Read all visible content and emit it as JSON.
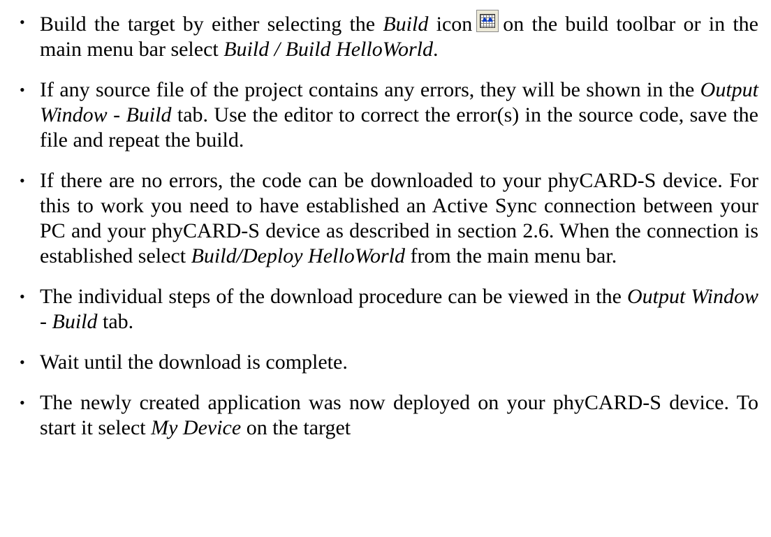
{
  "bullet_glyph": "•",
  "items": [
    {
      "parts": [
        {
          "t": "Build the target by either selecting the "
        },
        {
          "t": "Build",
          "i": true
        },
        {
          "t": " icon"
        },
        {
          "icon": "build-icon"
        },
        {
          "t": "on the build toolbar or in the main menu bar select "
        },
        {
          "t": "Build / Build HelloWorld",
          "i": true
        },
        {
          "t": "."
        }
      ]
    },
    {
      "parts": [
        {
          "t": "If any source file of the project contains any errors, they will be shown in the "
        },
        {
          "t": "Output Window",
          "i": true
        },
        {
          "t": " - "
        },
        {
          "t": "Build",
          "i": true
        },
        {
          "t": " tab. Use the editor to correct the error(s) in the source code, save the file and repeat the build."
        }
      ]
    },
    {
      "parts": [
        {
          "t": "If there are no errors, the code can be downloaded to your phyCARD-S device. For this to work you need to have established an Active Sync connection between your PC and your phyCARD-S device as described in section 2.6. When the connection is established select "
        },
        {
          "t": "Build/Deploy HelloWorld",
          "i": true
        },
        {
          "t": " from the main menu bar."
        }
      ]
    },
    {
      "parts": [
        {
          "t": "The individual steps of the download procedure can be viewed in the "
        },
        {
          "t": "Output Window - Build",
          "i": true
        },
        {
          "t": " tab."
        }
      ]
    },
    {
      "parts": [
        {
          "t": "Wait until the download is complete."
        }
      ]
    },
    {
      "parts": [
        {
          "t": "The newly created application was now deployed on your phyCARD-S device. To start it select "
        },
        {
          "t": "My Device",
          "i": true
        },
        {
          "t": " on the target"
        }
      ]
    }
  ]
}
